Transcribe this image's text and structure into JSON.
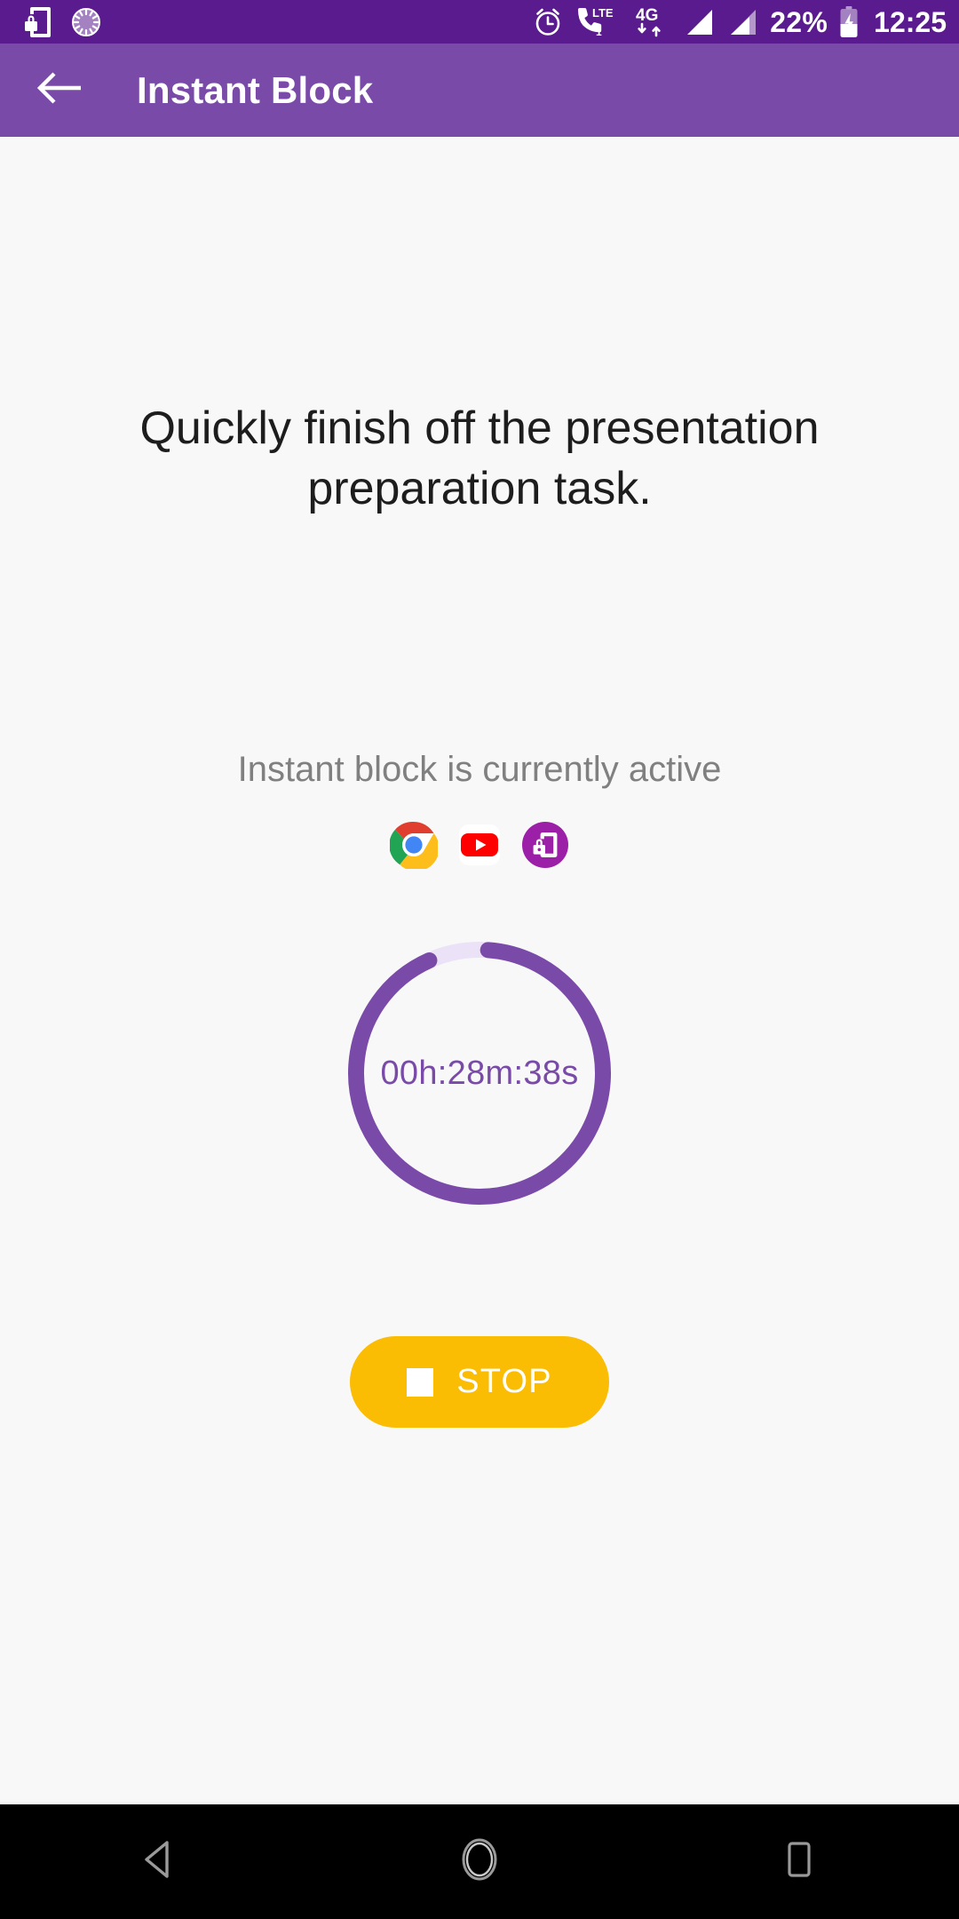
{
  "status_bar": {
    "left_icons": [
      {
        "name": "app-lock-phone-icon",
        "label": "App lock"
      },
      {
        "name": "sync-spinner-icon",
        "label": "Syncing"
      }
    ],
    "right_icons": [
      {
        "name": "alarm-clock-icon",
        "label": "Alarm set"
      },
      {
        "name": "volte-call-icon",
        "label": "VoLTE",
        "badge": "LTE",
        "sim": "1"
      },
      {
        "name": "mobile-data-4g-icon",
        "label": "4G",
        "network": "4G"
      },
      {
        "name": "signal-bars-sim1-icon",
        "label": "Signal SIM 1"
      },
      {
        "name": "signal-bars-sim2-icon",
        "label": "Signal SIM 2"
      }
    ],
    "battery_percent": "22%",
    "battery_state": "charging",
    "clock": "12:25"
  },
  "app_bar": {
    "back_icon": "arrow-left-icon",
    "title": "Instant Block"
  },
  "main": {
    "task_heading": "Quickly finish off the presentation preparation task.",
    "active_status": "Instant block is currently active",
    "blocked_apps": [
      {
        "name": "chrome-app-icon",
        "label": "Chrome"
      },
      {
        "name": "youtube-app-icon",
        "label": "YouTube"
      },
      {
        "name": "applock-app-icon",
        "label": "App Lock"
      }
    ],
    "timer": {
      "remaining": "00h:28m:38s",
      "hours": "00h",
      "minutes": "28m",
      "seconds": "38s",
      "progress_percent": 96,
      "ring_color": "#7a4aa8",
      "track_color": "#ece2f7"
    },
    "stop_button": {
      "label": "STOP",
      "icon": "stop-square-icon",
      "color": "#fbbc04"
    }
  },
  "nav_bar": {
    "buttons": [
      {
        "name": "nav-back-button",
        "label": "Back"
      },
      {
        "name": "nav-home-button",
        "label": "Home"
      },
      {
        "name": "nav-recents-button",
        "label": "Recents"
      }
    ]
  },
  "colors": {
    "status_bar_bg": "#5a1b8e",
    "app_bar_bg": "#7a4aa8",
    "page_bg": "#f8f8f8",
    "accent_purple": "#7a4aa8",
    "accent_amber": "#fbbc04",
    "muted_text": "#808080"
  }
}
